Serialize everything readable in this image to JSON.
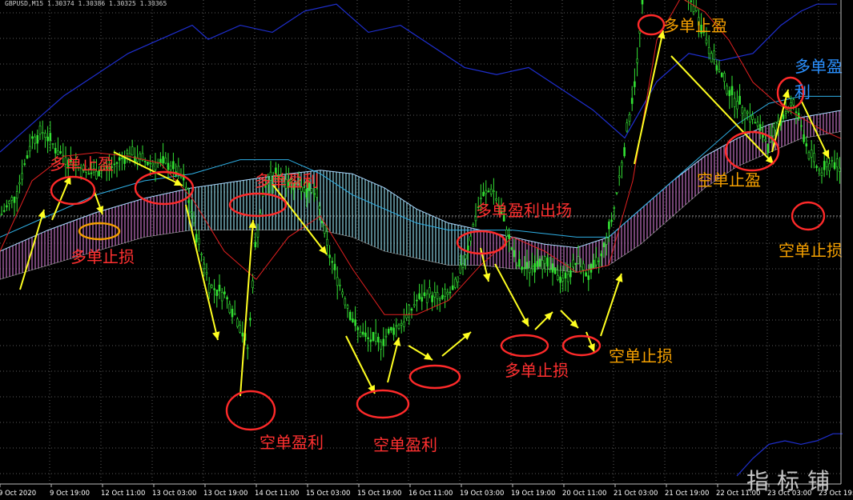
{
  "header": {
    "symbol_line": "GBPUSD,M15 1.30374 1.30386 1.30325 1.30365"
  },
  "watermark": {
    "text": "指标铺"
  },
  "colors": {
    "background": "#000000",
    "grid": "#5a5a5a",
    "axis_text": "#ffffff",
    "candle": "#33e033",
    "ma_red": "#e02020",
    "ma_blue_fast": "#2fb0e6",
    "ma_blue_slow": "#1f2fd0",
    "cloud_bull": "#c070c0",
    "cloud_bear": "#8ad0e0",
    "cloud_edge": "#a9d8ff",
    "arrow": "#ffff20",
    "circle_red": "#ff2a2a",
    "circle_orange": "#f5a000",
    "label_red": "#ff3030",
    "label_orange": "#f5a000",
    "label_blue": "#2a90ff"
  },
  "chart_data": {
    "type": "candlestick",
    "title": "",
    "xlabel": "",
    "ylabel": "",
    "grid": true,
    "x_ticks": [
      "9 Oct 2020",
      "9 Oct 19:00",
      "12 Oct 11:00",
      "13 Oct 03:00",
      "13 Oct 19:00",
      "14 Oct 11:00",
      "15 Oct 03:00",
      "15 Oct 19:00",
      "16 Oct 11:00",
      "19 Oct 03:00",
      "19 Oct 19:00",
      "20 Oct 11:00",
      "21 Oct 03:00",
      "21 Oct 19:00",
      "22 Oct 11:00",
      "23 Oct 03:00",
      "23 Oct 19:00"
    ],
    "price_trend": [
      [
        0,
        50
      ],
      [
        20,
        56
      ],
      [
        40,
        72
      ],
      [
        55,
        74
      ],
      [
        70,
        69
      ],
      [
        85,
        66
      ],
      [
        110,
        62
      ],
      [
        125,
        63
      ],
      [
        140,
        64
      ],
      [
        160,
        68
      ],
      [
        175,
        66
      ],
      [
        190,
        65
      ],
      [
        210,
        65
      ],
      [
        230,
        60
      ],
      [
        245,
        45
      ],
      [
        262,
        30
      ],
      [
        280,
        28
      ],
      [
        298,
        20
      ],
      [
        310,
        12
      ],
      [
        318,
        40
      ],
      [
        330,
        58
      ],
      [
        345,
        62
      ],
      [
        360,
        60
      ],
      [
        380,
        58
      ],
      [
        395,
        56
      ],
      [
        410,
        40
      ],
      [
        425,
        30
      ],
      [
        445,
        18
      ],
      [
        460,
        15
      ],
      [
        475,
        14
      ],
      [
        490,
        18
      ],
      [
        505,
        20
      ],
      [
        520,
        26
      ],
      [
        535,
        28
      ],
      [
        550,
        26
      ],
      [
        570,
        30
      ],
      [
        585,
        42
      ],
      [
        600,
        55
      ],
      [
        615,
        58
      ],
      [
        630,
        48
      ],
      [
        645,
        36
      ],
      [
        660,
        35
      ],
      [
        675,
        38
      ],
      [
        690,
        34
      ],
      [
        705,
        32
      ],
      [
        720,
        37
      ],
      [
        735,
        33
      ],
      [
        750,
        38
      ],
      [
        765,
        50
      ],
      [
        780,
        70
      ],
      [
        795,
        92
      ],
      [
        805,
        118
      ],
      [
        815,
        125
      ],
      [
        825,
        125
      ],
      [
        840,
        118
      ],
      [
        855,
        114
      ],
      [
        870,
        108
      ],
      [
        885,
        98
      ],
      [
        900,
        90
      ],
      [
        915,
        84
      ],
      [
        930,
        80
      ],
      [
        945,
        76
      ],
      [
        960,
        70
      ],
      [
        975,
        78
      ],
      [
        990,
        82
      ],
      [
        1000,
        76
      ],
      [
        1010,
        68
      ],
      [
        1025,
        62
      ],
      [
        1040,
        66
      ],
      [
        1050,
        62
      ]
    ],
    "ma_red": [
      [
        0,
        40
      ],
      [
        40,
        60
      ],
      [
        80,
        67
      ],
      [
        120,
        68
      ],
      [
        160,
        67
      ],
      [
        200,
        65
      ],
      [
        240,
        55
      ],
      [
        280,
        40
      ],
      [
        320,
        32
      ],
      [
        360,
        44
      ],
      [
        400,
        50
      ],
      [
        440,
        35
      ],
      [
        480,
        22
      ],
      [
        520,
        22
      ],
      [
        560,
        26
      ],
      [
        600,
        36
      ],
      [
        640,
        44
      ],
      [
        680,
        40
      ],
      [
        720,
        34
      ],
      [
        760,
        36
      ],
      [
        790,
        60
      ],
      [
        820,
        100
      ],
      [
        850,
        112
      ],
      [
        880,
        108
      ],
      [
        910,
        100
      ],
      [
        940,
        88
      ],
      [
        970,
        82
      ],
      [
        1000,
        78
      ],
      [
        1030,
        74
      ],
      [
        1050,
        72
      ]
    ],
    "ma_blue_fast": [
      [
        0,
        44
      ],
      [
        60,
        50
      ],
      [
        120,
        56
      ],
      [
        180,
        60
      ],
      [
        240,
        62
      ],
      [
        300,
        66
      ],
      [
        360,
        66
      ],
      [
        400,
        62
      ],
      [
        440,
        56
      ],
      [
        480,
        52
      ],
      [
        520,
        48
      ],
      [
        560,
        46
      ],
      [
        600,
        46
      ],
      [
        640,
        46
      ],
      [
        680,
        45
      ],
      [
        720,
        44
      ],
      [
        760,
        44
      ],
      [
        800,
        52
      ],
      [
        840,
        60
      ],
      [
        880,
        68
      ],
      [
        920,
        76
      ],
      [
        960,
        82
      ],
      [
        1000,
        84
      ],
      [
        1050,
        84
      ]
    ],
    "ma_blue_slow_upper": [
      [
        0,
        100
      ],
      [
        40,
        108
      ],
      [
        80,
        116
      ],
      [
        120,
        122
      ],
      [
        160,
        128
      ],
      [
        200,
        132
      ],
      [
        240,
        136
      ],
      [
        260,
        132
      ],
      [
        300,
        136
      ],
      [
        340,
        134
      ],
      [
        380,
        140
      ],
      [
        420,
        142
      ],
      [
        460,
        134
      ],
      [
        500,
        136
      ],
      [
        540,
        130
      ],
      [
        580,
        124
      ],
      [
        620,
        122
      ],
      [
        660,
        124
      ],
      [
        700,
        118
      ],
      [
        740,
        112
      ],
      [
        780,
        104
      ],
      [
        820,
        120
      ],
      [
        860,
        128
      ],
      [
        900,
        126
      ],
      [
        940,
        128
      ],
      [
        975,
        136
      ],
      [
        1000,
        140
      ],
      [
        1020,
        142
      ],
      [
        1045,
        142
      ]
    ],
    "ma_blue_slow_lower": [
      [
        920,
        0
      ],
      [
        940,
        5
      ],
      [
        960,
        9
      ],
      [
        980,
        10
      ],
      [
        1000,
        9
      ],
      [
        1020,
        10
      ],
      [
        1040,
        12
      ],
      [
        1052,
        12
      ]
    ],
    "cloud_span_a": [
      [
        0,
        40
      ],
      [
        60,
        46
      ],
      [
        120,
        51
      ],
      [
        180,
        55
      ],
      [
        240,
        58
      ],
      [
        300,
        60
      ],
      [
        360,
        62
      ],
      [
        400,
        63
      ],
      [
        440,
        62
      ],
      [
        480,
        58
      ],
      [
        520,
        52
      ],
      [
        560,
        48
      ],
      [
        600,
        46
      ],
      [
        640,
        44
      ],
      [
        680,
        42
      ],
      [
        720,
        41
      ],
      [
        760,
        44
      ],
      [
        800,
        52
      ],
      [
        840,
        60
      ],
      [
        880,
        67
      ],
      [
        920,
        72
      ],
      [
        960,
        76
      ],
      [
        1000,
        78
      ],
      [
        1050,
        80
      ]
    ],
    "cloud_span_b": [
      [
        0,
        32
      ],
      [
        60,
        36
      ],
      [
        120,
        40
      ],
      [
        180,
        44
      ],
      [
        240,
        46
      ],
      [
        300,
        46
      ],
      [
        360,
        46
      ],
      [
        400,
        46
      ],
      [
        440,
        44
      ],
      [
        480,
        40
      ],
      [
        520,
        38
      ],
      [
        560,
        36
      ],
      [
        600,
        36
      ],
      [
        640,
        35
      ],
      [
        680,
        35
      ],
      [
        720,
        34
      ],
      [
        760,
        36
      ],
      [
        800,
        42
      ],
      [
        840,
        50
      ],
      [
        880,
        58
      ],
      [
        920,
        64
      ],
      [
        960,
        68
      ],
      [
        1000,
        72
      ],
      [
        1050,
        74
      ]
    ],
    "annotations": [
      {
        "text": "多单止盈",
        "color": "label_red"
      },
      {
        "text": "多单止损",
        "color": "label_red"
      },
      {
        "text": "多单盈利",
        "color": "label_red"
      },
      {
        "text": "空单盈利",
        "color": "label_red"
      },
      {
        "text": "空单盈利",
        "color": "label_red"
      },
      {
        "text": "多单盈利出场",
        "color": "label_red"
      },
      {
        "text": "多单止损",
        "color": "label_red"
      },
      {
        "text": "空单止损",
        "color": "label_orange"
      },
      {
        "text": "多单止盈",
        "color": "label_orange"
      },
      {
        "text": "多单盈",
        "color": "label_blue"
      },
      {
        "text": "利",
        "color": "label_blue"
      },
      {
        "text": "空单止盈",
        "color": "label_orange"
      },
      {
        "text": "空单止损",
        "color": "label_orange"
      }
    ]
  }
}
